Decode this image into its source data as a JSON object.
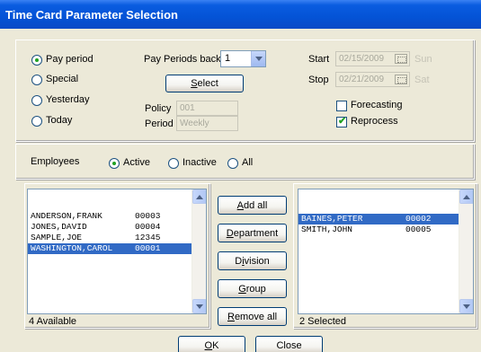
{
  "window": {
    "title": "Time Card Parameter Selection"
  },
  "params": {
    "pay_period_label": "Pay period",
    "special_label": "Special",
    "yesterday_label": "Yesterday",
    "today_label": "Today",
    "pay_periods_back_label": "Pay Periods back",
    "pay_periods_back_value": "1",
    "select_label": "Select",
    "select_mnemonic": "S",
    "select_rest": "elect",
    "policy_label": "Policy",
    "policy_value": "001",
    "period_label": "Period",
    "period_value": "Weekly",
    "start_label": "Start",
    "start_date": "02/15/2009",
    "start_day": "Sun",
    "stop_label": "Stop",
    "stop_date": "02/21/2009",
    "stop_day": "Sat",
    "forecasting_label": "Forecasting",
    "forecasting_checked": false,
    "reprocess_label": "Reprocess",
    "reprocess_checked": true,
    "selected_period_option": "Pay period"
  },
  "employees": {
    "label": "Employees",
    "active_label": "Active",
    "inactive_label": "Inactive",
    "all_label": "All",
    "selected_filter": "Active"
  },
  "available": {
    "rows": [
      {
        "name": "ANDERSON,FRANK",
        "code": "00003",
        "selected": false
      },
      {
        "name": "JONES,DAVID",
        "code": "00004",
        "selected": false
      },
      {
        "name": "SAMPLE,JOE",
        "code": "12345",
        "selected": false
      },
      {
        "name": "WASHINGTON,CAROL",
        "code": "00001",
        "selected": true
      }
    ],
    "count_label": "4 Available"
  },
  "selected": {
    "rows": [
      {
        "name": "BAINES,PETER",
        "code": "00002",
        "selected": true
      },
      {
        "name": "SMITH,JOHN",
        "code": "00005",
        "selected": false
      }
    ],
    "count_label": "2 Selected"
  },
  "actions": {
    "add_all_mnemonic": "A",
    "add_all_rest": "dd all",
    "department_mnemonic": "D",
    "department_rest": "epartment",
    "division_pre": "D",
    "division_mnemonic": "i",
    "division_rest": "vision",
    "group_mnemonic": "G",
    "group_rest": "roup",
    "remove_all_mnemonic": "R",
    "remove_all_rest": "emove all",
    "ok_mnemonic": "O",
    "ok_rest": "K",
    "close_label": "Close"
  }
}
